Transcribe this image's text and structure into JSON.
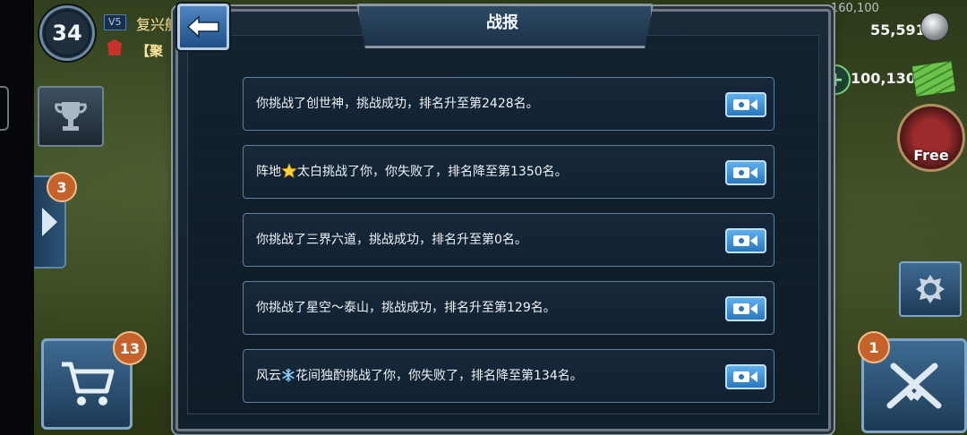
{
  "hud": {
    "level": "34",
    "vip_label": "V5",
    "player_name": "复兴航",
    "guild_name": "【聚",
    "resource_cap": "160,100",
    "coins": "55,591",
    "cash": "100,130",
    "gift_label": "Free",
    "badge_side": "3",
    "badge_cart": "13",
    "badge_attack": "1"
  },
  "dialog": {
    "title": "战报",
    "reports": [
      {
        "prefix": "你挑战了创世神，挑战成功，排名升至第2428名。",
        "icon": "",
        "suffix": ""
      },
      {
        "prefix": "阵地",
        "icon": "star-icon",
        "suffix": "太白挑战了你，你失败了，排名降至第1350名。"
      },
      {
        "prefix": "你挑战了三界六道，挑战成功，排名升至第0名。",
        "icon": "",
        "suffix": ""
      },
      {
        "prefix": "你挑战了星空～泰山，挑战成功，排名升至第129名。",
        "icon": "",
        "suffix": ""
      },
      {
        "prefix": "风云",
        "icon": "snowflake-icon",
        "suffix": "花间独酌挑战了你，你失败了，排名降至第134名。"
      }
    ]
  },
  "colors": {
    "panel": "#12202c",
    "row_border": "#5e7f9e",
    "replay_button": "#3b8fd6",
    "text": "#f0f3f6"
  }
}
